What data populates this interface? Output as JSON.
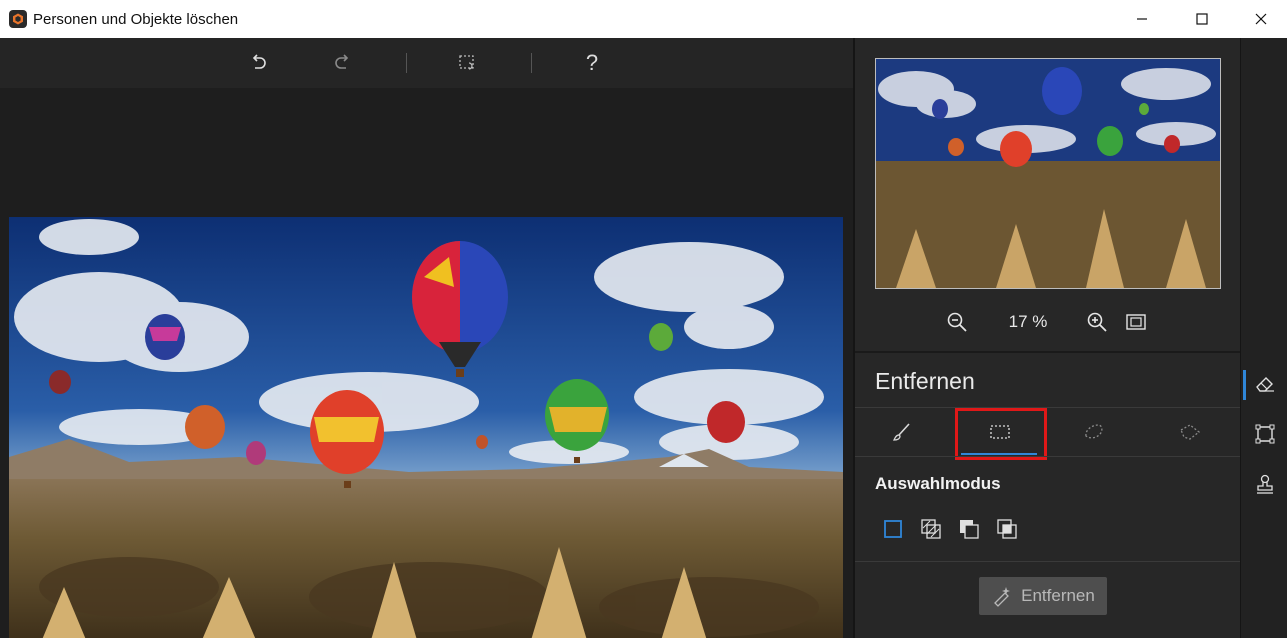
{
  "window": {
    "title": "Personen und Objekte löschen",
    "app_icon": "app-logo-icon",
    "controls": [
      "minimize-icon",
      "maximize-icon",
      "close-icon"
    ]
  },
  "toolbar": {
    "buttons": [
      {
        "icon": "undo-icon",
        "tooltip": ""
      },
      {
        "icon": "redo-icon",
        "tooltip": ""
      },
      {
        "icon": "selection-reset-icon",
        "tooltip": ""
      },
      {
        "icon": "help-icon",
        "label": "?"
      }
    ]
  },
  "preview": {
    "zoom_level": "17 %",
    "zoom_out_icon": "zoom-out-icon",
    "zoom_in_icon": "zoom-in-icon",
    "fit_icon": "fit-to-screen-icon"
  },
  "panel": {
    "section_title": "Entfernen",
    "tools": [
      {
        "name": "brush",
        "icon": "brush-icon"
      },
      {
        "name": "rectangle-select",
        "icon": "rectangle-select-icon",
        "active": true
      },
      {
        "name": "lasso",
        "icon": "lasso-icon"
      },
      {
        "name": "polygon-lasso",
        "icon": "polygon-lasso-icon"
      }
    ],
    "selection_mode_label": "Auswahlmodus",
    "modes": [
      "new-selection-icon",
      "add-selection-icon",
      "subtract-selection-icon",
      "intersect-selection-icon"
    ],
    "remove_button_label": "Entfernen"
  },
  "rail": {
    "items": [
      "eraser-icon",
      "crop-select-icon",
      "stamp-icon"
    ]
  },
  "colors": {
    "accent": "#2f86d8",
    "highlight": "#e01818",
    "panel_bg": "#272727"
  }
}
